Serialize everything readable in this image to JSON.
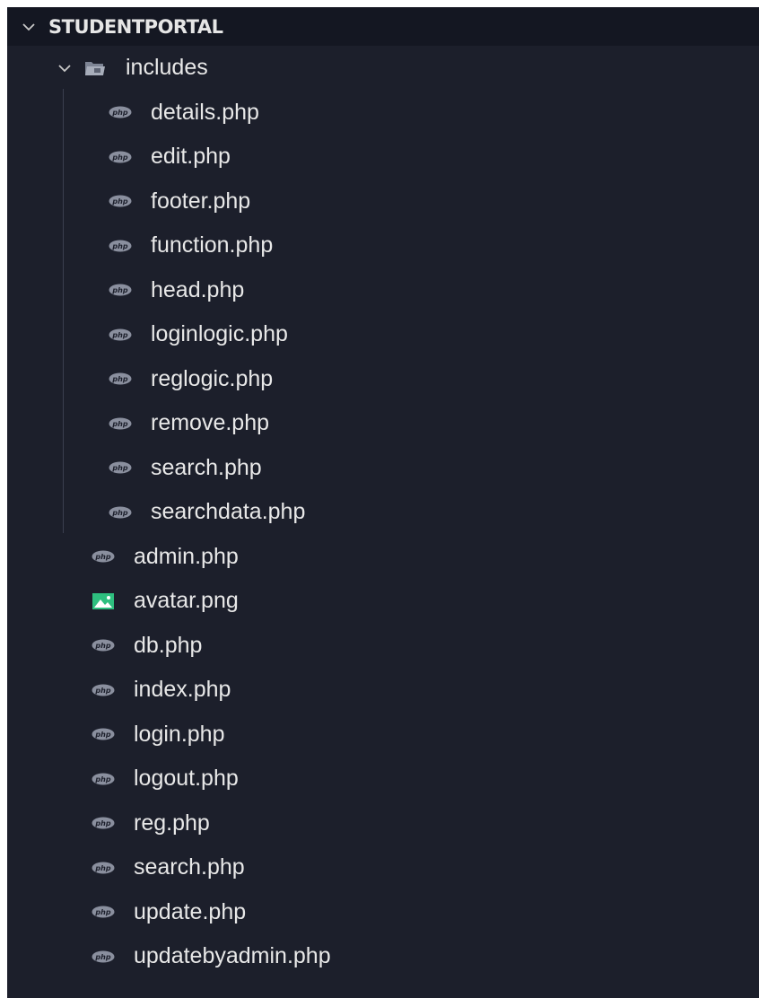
{
  "explorer": {
    "root_title": "STUDENTPORTAL",
    "colors": {
      "background": "#1c1f2b",
      "header_background": "#141722",
      "text": "#e8e8e8",
      "icon_php": "#8a8f9e",
      "icon_image": "#2ebf7f",
      "chevron": "#c8c8c8"
    },
    "folder": {
      "name": "includes",
      "icon": "folder-open-icon",
      "expanded": true,
      "children": [
        {
          "name": "details.php",
          "icon": "php-icon"
        },
        {
          "name": "edit.php",
          "icon": "php-icon"
        },
        {
          "name": "footer.php",
          "icon": "php-icon"
        },
        {
          "name": "function.php",
          "icon": "php-icon"
        },
        {
          "name": "head.php",
          "icon": "php-icon"
        },
        {
          "name": "loginlogic.php",
          "icon": "php-icon"
        },
        {
          "name": "reglogic.php",
          "icon": "php-icon"
        },
        {
          "name": "remove.php",
          "icon": "php-icon"
        },
        {
          "name": "search.php",
          "icon": "php-icon"
        },
        {
          "name": "searchdata.php",
          "icon": "php-icon"
        }
      ]
    },
    "files": [
      {
        "name": "admin.php",
        "icon": "php-icon"
      },
      {
        "name": "avatar.png",
        "icon": "image-icon"
      },
      {
        "name": "db.php",
        "icon": "php-icon"
      },
      {
        "name": "index.php",
        "icon": "php-icon"
      },
      {
        "name": "login.php",
        "icon": "php-icon"
      },
      {
        "name": "logout.php",
        "icon": "php-icon"
      },
      {
        "name": "reg.php",
        "icon": "php-icon"
      },
      {
        "name": "search.php",
        "icon": "php-icon"
      },
      {
        "name": "update.php",
        "icon": "php-icon"
      },
      {
        "name": "updatebyadmin.php",
        "icon": "php-icon"
      }
    ]
  }
}
